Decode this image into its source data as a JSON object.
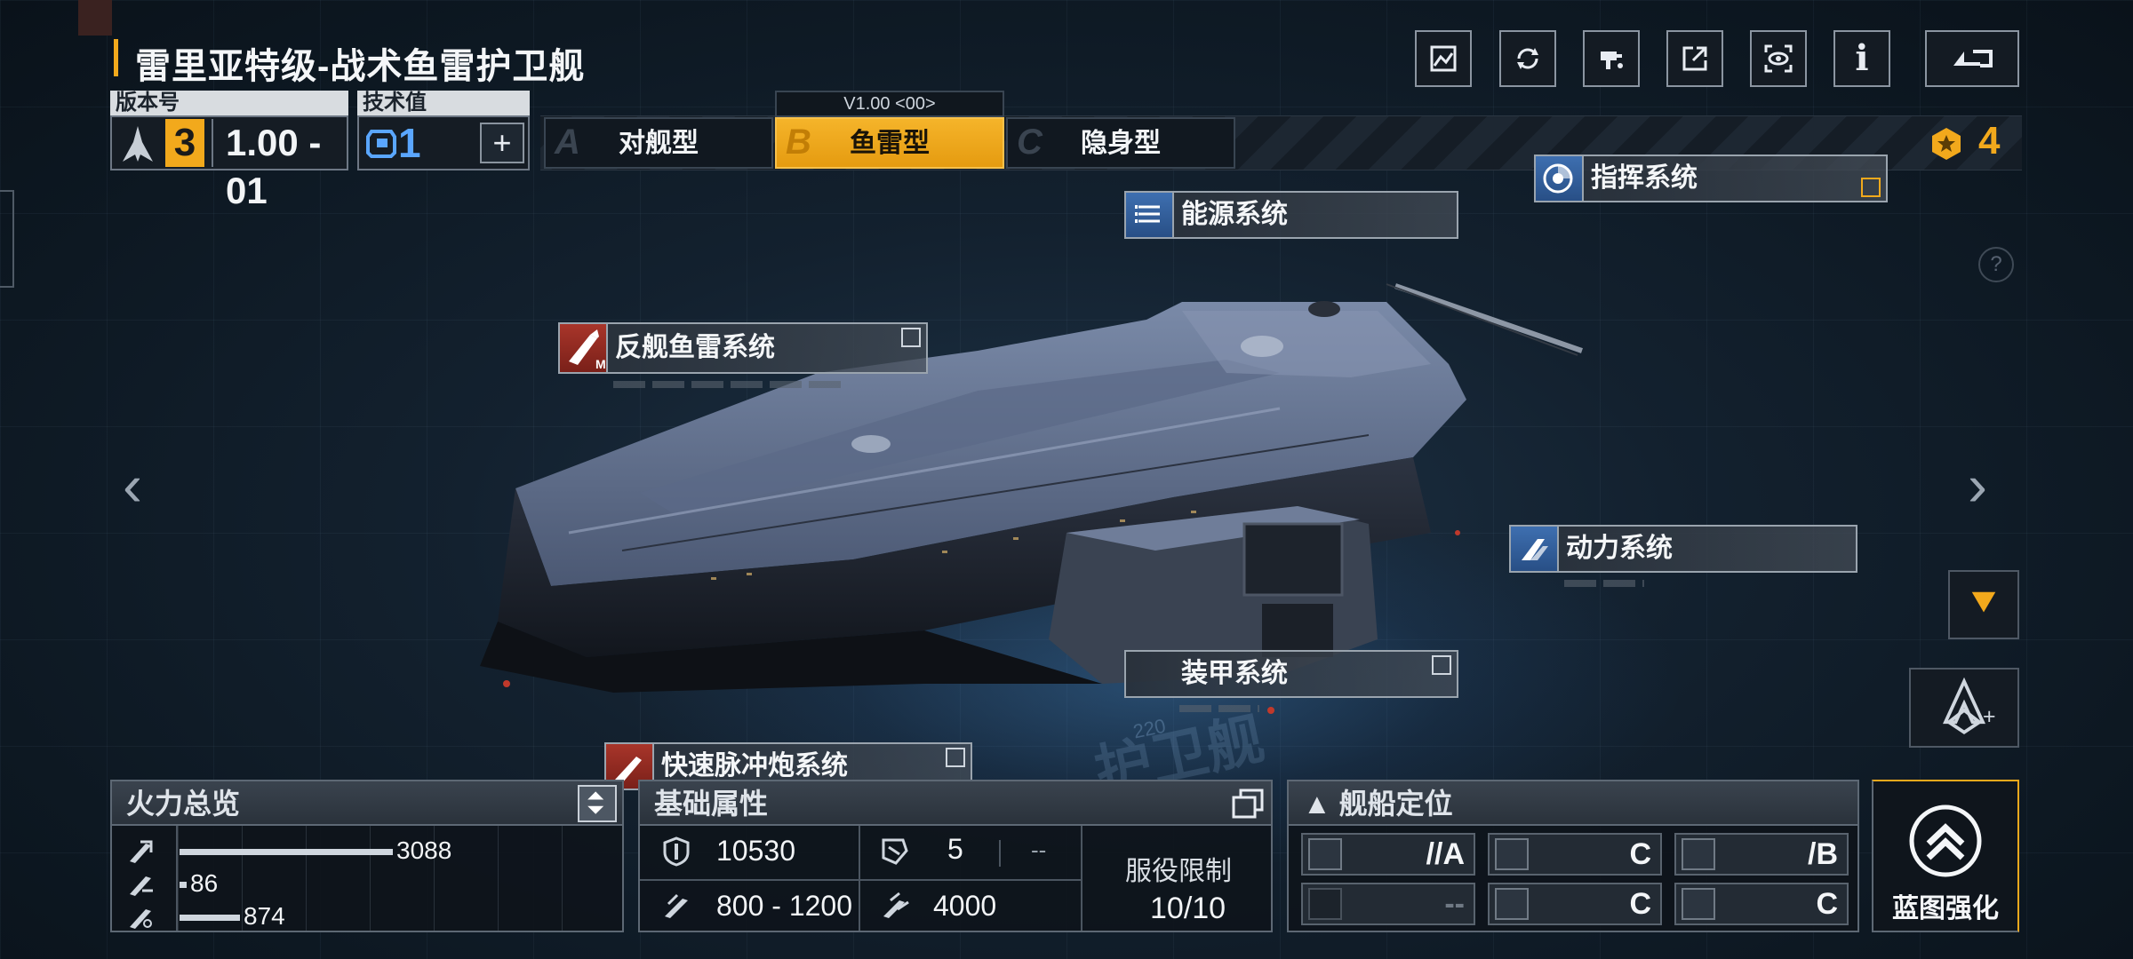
{
  "title": "雷里亚特级-战术鱼雷护卫舰",
  "version": {
    "label": "版本号",
    "major": "3",
    "minor": "1.00 - 01"
  },
  "tech": {
    "label": "技术值",
    "value": "1"
  },
  "tabs": [
    {
      "letter": "A",
      "label": "对舰型"
    },
    {
      "letter": "B",
      "label": "鱼雷型",
      "version_tag": "V1.00 <00>"
    },
    {
      "letter": "C",
      "label": "隐身型"
    }
  ],
  "medal_count": "4",
  "toolbar": {
    "icons": [
      "screenshot-icon",
      "rotate-icon",
      "paint-icon",
      "share-icon",
      "view-icon",
      "info-icon",
      "back-icon"
    ],
    "info_glyph": "i"
  },
  "systems": {
    "energy": "能源系统",
    "command": "指挥系统",
    "anti_torpedo": "反舰鱼雷系统",
    "anti_torpedo_badge": "M",
    "power": "动力系统",
    "armor": "装甲系统",
    "pulse": "快速脉冲炮系统"
  },
  "background_text": {
    "watermark": "护卫舰",
    "number": "220"
  },
  "firepower": {
    "title": "火力总览",
    "max": 3088,
    "rows": [
      {
        "icon": "anti-ship-icon",
        "value": 3088
      },
      {
        "icon": "anti-air-icon",
        "value": 86
      },
      {
        "icon": "siege-icon",
        "value": 874
      }
    ]
  },
  "base_stats": {
    "title": "基础属性",
    "hp": "10530",
    "evasion": "5",
    "evasion_extra": "--",
    "range": "800 - 1200",
    "speed": "4000",
    "service_label": "服役限制",
    "service_value": "10/10"
  },
  "positioning": {
    "title": "▲ 舰船定位",
    "cells": [
      {
        "icon": "anti-ship-role-icon",
        "grade": "//A",
        "dim": false
      },
      {
        "icon": "anti-aircraft-role-icon",
        "grade": "C",
        "dim": false
      },
      {
        "icon": "siege-role-icon",
        "grade": "/B",
        "dim": false
      },
      {
        "icon": "support-role-icon",
        "grade": "--",
        "dim": true
      },
      {
        "icon": "defense-role-icon",
        "grade": "C",
        "dim": false
      },
      {
        "icon": "utility-role-icon",
        "grade": "C",
        "dim": false
      }
    ]
  },
  "blueprint_button": "蓝图强化",
  "help_glyph": "?",
  "nav": {
    "left": "‹",
    "right": "›"
  },
  "colors": {
    "accent": "#f2a91c",
    "tech_blue": "#5aa6ff",
    "panel_border": "#5d6874"
  }
}
